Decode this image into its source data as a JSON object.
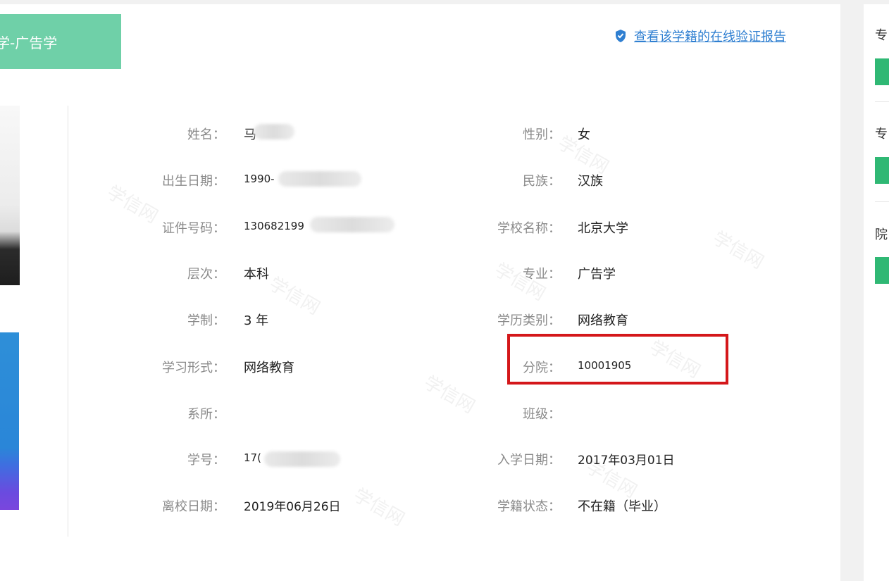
{
  "header": {
    "major_tag": "学-广告学",
    "verify_link": "查看该学籍的在线验证报告"
  },
  "fields": {
    "name_label": "姓名：",
    "name_value": "马",
    "gender_label": "性别：",
    "gender_value": "女",
    "birth_label": "出生日期：",
    "birth_value": "1990-",
    "ethnicity_label": "民族：",
    "ethnicity_value": "汉族",
    "id_label": "证件号码：",
    "id_value": "130682199",
    "school_label": "学校名称：",
    "school_value": "北京大学",
    "level_label": "层次：",
    "level_value": "本科",
    "major_label": "专业：",
    "major_value": "广告学",
    "duration_label": "学制：",
    "duration_value": "3 年",
    "edu_type_label": "学历类别：",
    "edu_type_value": "网络教育",
    "study_form_label": "学习形式：",
    "study_form_value": "网络教育",
    "branch_label": "分院：",
    "branch_value": "10001905",
    "dept_label": "系所：",
    "dept_value": "",
    "class_label": "班级：",
    "class_value": "",
    "student_no_label": "学号：",
    "student_no_value": "17(",
    "enroll_date_label": "入学日期：",
    "enroll_date_value": "2017年03月01日",
    "leave_date_label": "离校日期：",
    "leave_date_value": "2019年06月26日",
    "status_label": "学籍状态：",
    "status_value": "不在籍（毕业）"
  },
  "side_panel": {
    "labels": [
      "专",
      "专",
      "院"
    ]
  },
  "watermark_text": "学信网",
  "colors": {
    "tag_bg": "#6fd0a8",
    "link": "#2f7fd1",
    "highlight": "#d4171a",
    "side_btn": "#2fb874"
  },
  "icons": {
    "verify": "shield-check-icon"
  }
}
